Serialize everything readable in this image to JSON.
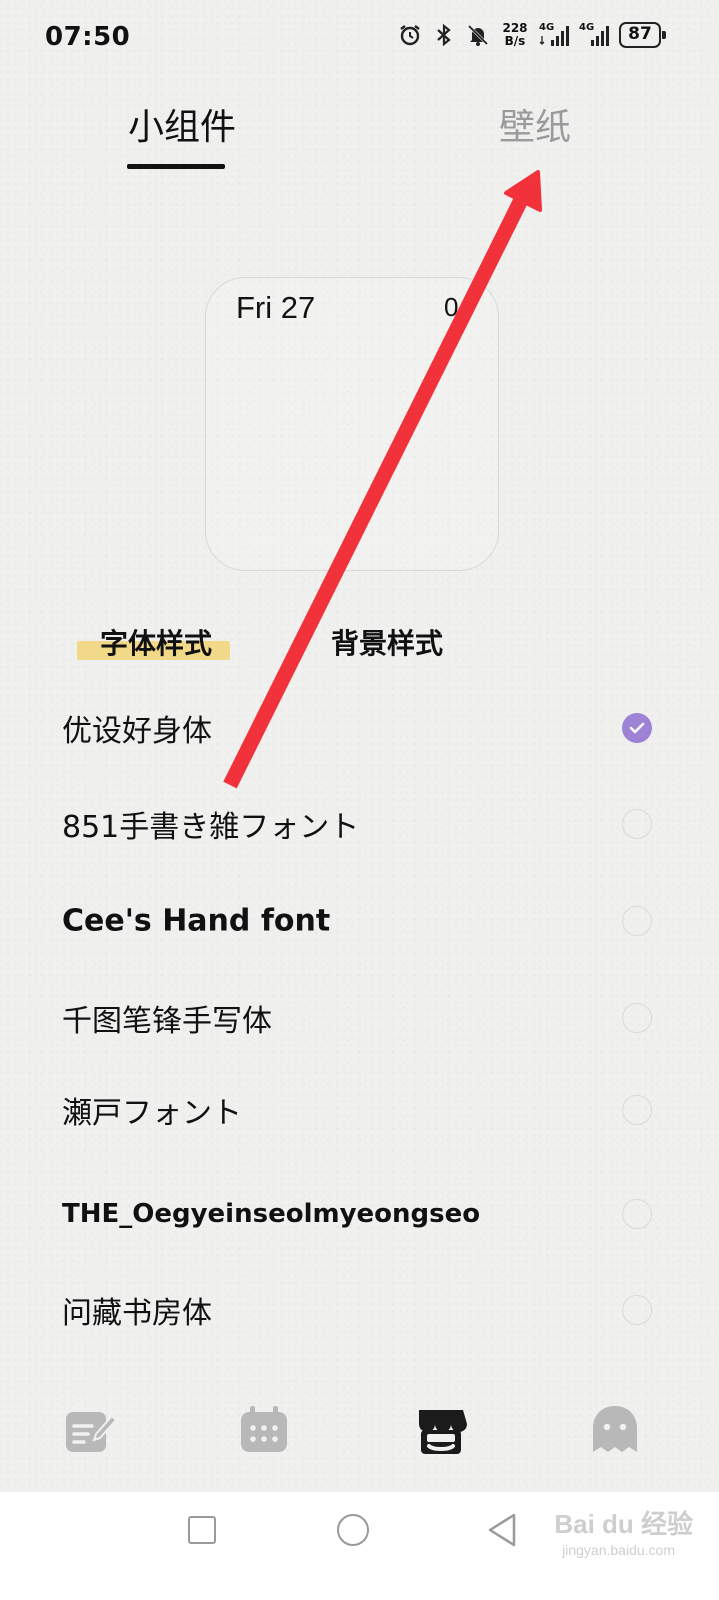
{
  "status_bar": {
    "time": "07:50",
    "net_speed_value": "228",
    "net_speed_unit": "B/s",
    "sim1_label": "4G",
    "sim2_label": "4G",
    "battery": "87",
    "icons": [
      "alarm-icon",
      "bluetooth-icon",
      "mute-bell-icon",
      "signal-icon",
      "battery-icon"
    ]
  },
  "tabs": {
    "widgets": "小组件",
    "wallpaper": "壁纸",
    "active": "widgets"
  },
  "widget_preview": {
    "date": "Fri 27",
    "number": "0"
  },
  "section_tabs": {
    "font_style": "字体样式",
    "background_style": "背景样式",
    "active": "font_style"
  },
  "fonts": [
    {
      "name": "优设好身体",
      "selected": true
    },
    {
      "name": "851手書き雑フォント",
      "selected": false
    },
    {
      "name": "Cee's Hand font",
      "selected": false
    },
    {
      "name": "千图笔锋手写体",
      "selected": false
    },
    {
      "name": "瀬戸フォント",
      "selected": false
    },
    {
      "name": "THE_Oegyeinseolmyeongseo",
      "selected": false
    },
    {
      "name": "问藏书房体",
      "selected": false
    }
  ],
  "bottom_nav": [
    "note-edit-icon",
    "calendar-icon",
    "store-icon",
    "ghost-chat-icon"
  ],
  "watermark": {
    "text": "Bai du 经验",
    "sub": "jingyan.baidu.com"
  },
  "colors": {
    "accent": "#9d82d6",
    "highlight": "#f2d98a",
    "arrow": "#f2323a"
  }
}
